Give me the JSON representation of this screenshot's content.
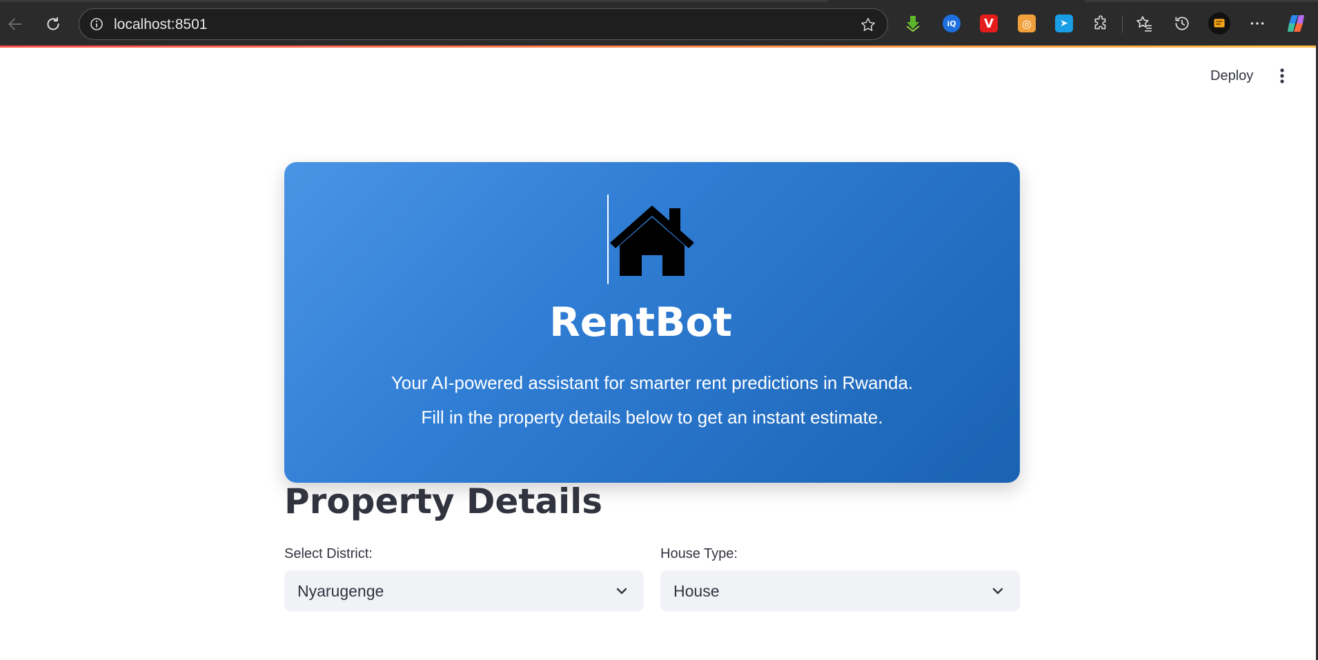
{
  "browser": {
    "url": "localhost:8501",
    "icons": {
      "back": "back-arrow-icon",
      "reload": "reload-icon",
      "site_info": "info-icon",
      "favorite": "star-icon",
      "extensions": "puzzle-icon",
      "favorites_list": "favorites-icon",
      "history": "history-icon",
      "more": "more-icon"
    },
    "extensions": [
      {
        "name": "download-extension-icon",
        "color": "#4caf1c",
        "glyph": "⬇"
      },
      {
        "name": "iq-extension-icon",
        "color": "#1e6fe0",
        "glyph": "iQ"
      },
      {
        "name": "vivaldi-extension-icon",
        "color": "#e51c1c",
        "glyph": "V"
      },
      {
        "name": "orange-extension-icon",
        "color": "#f2a03d",
        "glyph": "◎"
      },
      {
        "name": "send-extension-icon",
        "color": "#1a9ee6",
        "glyph": "➤"
      }
    ]
  },
  "app": {
    "deploy_label": "Deploy",
    "menu_icon": "kebab-menu-icon"
  },
  "hero": {
    "icon": "house-icon",
    "title": "RentBot",
    "subtitle_line1": "Your AI-powered assistant for smarter rent predictions in Rwanda.",
    "subtitle_line2": "Fill in the property details below to get an instant estimate.",
    "gradient_start": "#4a94e4",
    "gradient_end": "#1a62b2"
  },
  "form": {
    "heading": "Property Details",
    "district_label": "Select District:",
    "district_value": "Nyarugenge",
    "house_type_label": "House Type:",
    "house_type_value": "House"
  }
}
